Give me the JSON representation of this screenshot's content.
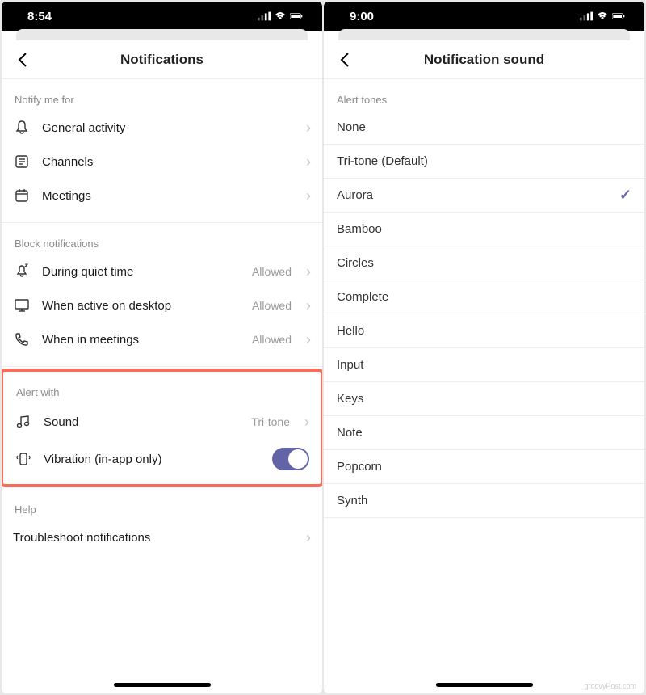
{
  "left": {
    "time": "8:54",
    "title": "Notifications",
    "sections": {
      "notify_me": {
        "header": "Notify me for",
        "items": [
          {
            "label": "General activity"
          },
          {
            "label": "Channels"
          },
          {
            "label": "Meetings"
          }
        ]
      },
      "block": {
        "header": "Block notifications",
        "items": [
          {
            "label": "During quiet time",
            "value": "Allowed"
          },
          {
            "label": "When active on desktop",
            "value": "Allowed"
          },
          {
            "label": "When in meetings",
            "value": "Allowed"
          }
        ]
      },
      "alert": {
        "header": "Alert with",
        "sound": {
          "label": "Sound",
          "value": "Tri-tone"
        },
        "vibration": {
          "label": "Vibration (in-app only)",
          "on": true
        }
      },
      "help": {
        "header": "Help",
        "items": [
          {
            "label": "Troubleshoot notifications"
          }
        ]
      }
    }
  },
  "right": {
    "time": "9:00",
    "title": "Notification sound",
    "section_header": "Alert tones",
    "tones": [
      "None",
      "Tri-tone (Default)",
      "Aurora",
      "Bamboo",
      "Circles",
      "Complete",
      "Hello",
      "Input",
      "Keys",
      "Note",
      "Popcorn",
      "Synth"
    ],
    "selected_index": 2
  },
  "watermark": "groovyPost.com"
}
